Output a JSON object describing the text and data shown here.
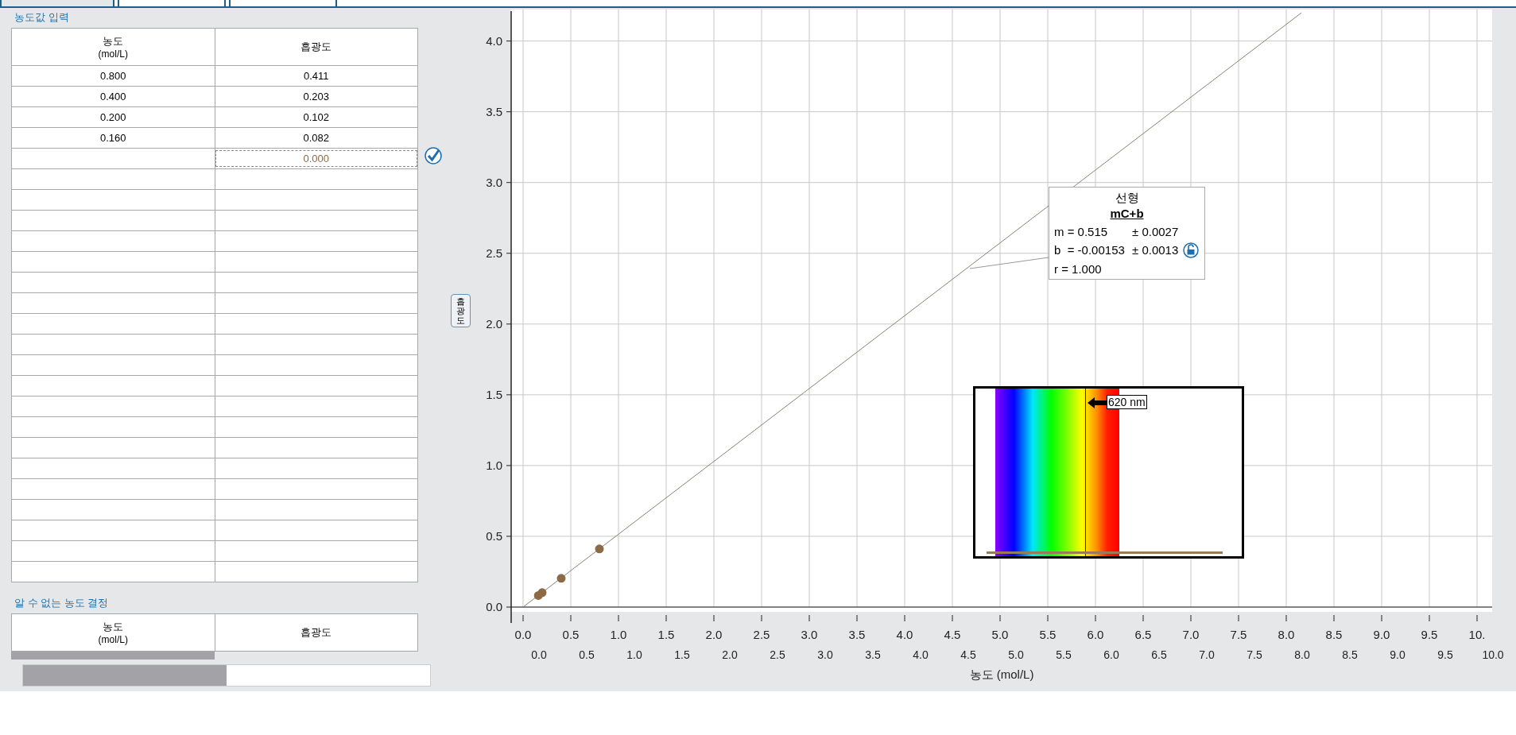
{
  "entry_section": {
    "title": "농도값 입력",
    "columns": [
      {
        "name": "농도",
        "unit": "(mol/L)"
      },
      {
        "name": "흡광도"
      }
    ],
    "rows": [
      [
        "0.800",
        "0.411"
      ],
      [
        "0.400",
        "0.203"
      ],
      [
        "0.200",
        "0.102"
      ],
      [
        "0.160",
        "0.082"
      ]
    ],
    "edit_value": "0.000"
  },
  "unknown_section": {
    "title": "알 수 없는 농도 결정",
    "columns": [
      {
        "name": "농도",
        "unit": "(mol/L)"
      },
      {
        "name": "흡광도"
      }
    ]
  },
  "tabs": [
    {
      "selected": true
    },
    {
      "selected": false
    },
    {
      "selected": false
    }
  ],
  "chart_data": {
    "type": "scatter",
    "xlabel": "농도 (mol/L)",
    "grid": true,
    "series": [
      {
        "name": "흡광도",
        "type": "scatter",
        "color": "#8b6a45",
        "x": [
          0.8,
          0.4,
          0.2,
          0.16
        ],
        "values": [
          0.411,
          0.203,
          0.102,
          0.082
        ]
      },
      {
        "name": "선형",
        "type": "line",
        "color": "#8a8078",
        "x": [
          0,
          8.16
        ],
        "values": [
          0,
          4.2
        ]
      }
    ],
    "xlim": [
      0,
      10
    ],
    "ylim": [
      0,
      4.2
    ],
    "xticks": [
      {
        "value": 0,
        "label": "0.0"
      },
      {
        "value": 0.5,
        "label": "0.5"
      },
      {
        "value": 1,
        "label": "1.0"
      },
      {
        "value": 1.5,
        "label": "1.5"
      },
      {
        "value": 2,
        "label": "2.0"
      },
      {
        "value": 2.5,
        "label": "2.5"
      },
      {
        "value": 3,
        "label": "3.0"
      },
      {
        "value": 3.5,
        "label": "3.5"
      },
      {
        "value": 4,
        "label": "4.0"
      },
      {
        "value": 4.5,
        "label": "4.5"
      },
      {
        "value": 5,
        "label": "5.0"
      },
      {
        "value": 5.5,
        "label": "5.5"
      },
      {
        "value": 6,
        "label": "6.0"
      },
      {
        "value": 6.5,
        "label": "6.5"
      },
      {
        "value": 7,
        "label": "7.0"
      },
      {
        "value": 7.5,
        "label": "7.5"
      },
      {
        "value": 8,
        "label": "8.0"
      },
      {
        "value": 8.5,
        "label": "8.5"
      },
      {
        "value": 9,
        "label": "9.0"
      },
      {
        "value": 9.5,
        "label": "9.5"
      },
      {
        "value": 10,
        "label": "10."
      }
    ],
    "yticks": [
      {
        "value": 0,
        "label": "0.0"
      },
      {
        "value": 0.5,
        "label": "0.5"
      },
      {
        "value": 1,
        "label": "1.0"
      },
      {
        "value": 1.5,
        "label": "1.5"
      },
      {
        "value": 2,
        "label": "2.0"
      },
      {
        "value": 2.5,
        "label": "2.5"
      },
      {
        "value": 3,
        "label": "3.0"
      },
      {
        "value": 3.5,
        "label": "3.5"
      },
      {
        "value": 4,
        "label": "4.0"
      }
    ]
  },
  "x_tick_echo": [
    "0.0",
    "0.5",
    "1.0",
    "1.5",
    "2.0",
    "2.5",
    "3.0",
    "3.5",
    "4.0",
    "4.5",
    "5.0",
    "5.5",
    "6.0",
    "6.5",
    "7.0",
    "7.5",
    "8.0",
    "8.5",
    "9.0",
    "9.5",
    "10.0"
  ],
  "fit_box": {
    "formula": "mC+b",
    "params": [
      {
        "label": "m = 0.515",
        "error": "± 0.0027"
      },
      {
        "label": "b  = -0.00153",
        "error": "± 0.0013",
        "locked": false
      }
    ],
    "r": "r = 1.000"
  },
  "spectrum": {
    "wavelength": "620 nm"
  }
}
